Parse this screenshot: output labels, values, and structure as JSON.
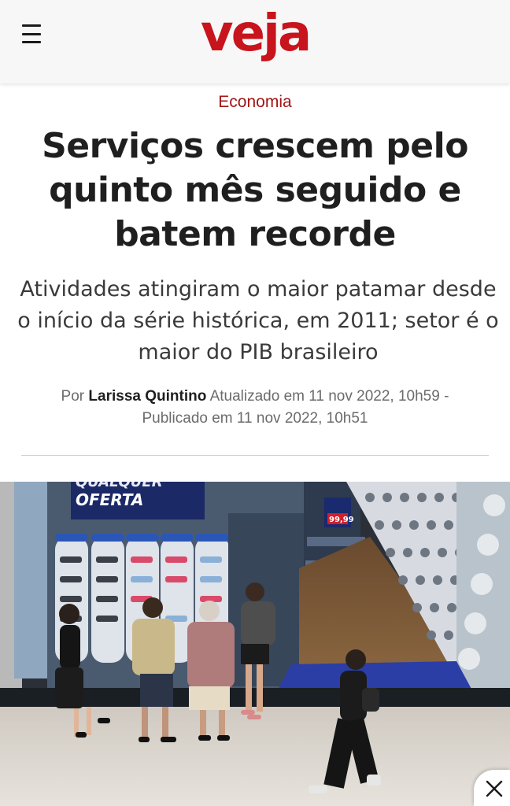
{
  "header": {
    "logo": "veja",
    "menu_icon": "hamburger-menu-icon",
    "brand_color": "#c8141c"
  },
  "article": {
    "category": "Economia",
    "headline": "Serviços crescem pelo quinto mês seguido e batem recorde",
    "subheadline": "Atividades atingiram o maior patamar desde o início da série histórica, em 2011; setor é o maior do PIB brasileiro",
    "byline": {
      "prefix": "Por",
      "author": "Larissa Quintino",
      "updated": "Atualizado em 11 nov 2022, 10h59 -",
      "published": "Publicado em 11 nov 2022, 10h51"
    }
  },
  "photo": {
    "store_sign": "QUALQUER OFERTA",
    "price_tag": "99,99"
  },
  "ad_close": {
    "icon": "close-icon"
  }
}
